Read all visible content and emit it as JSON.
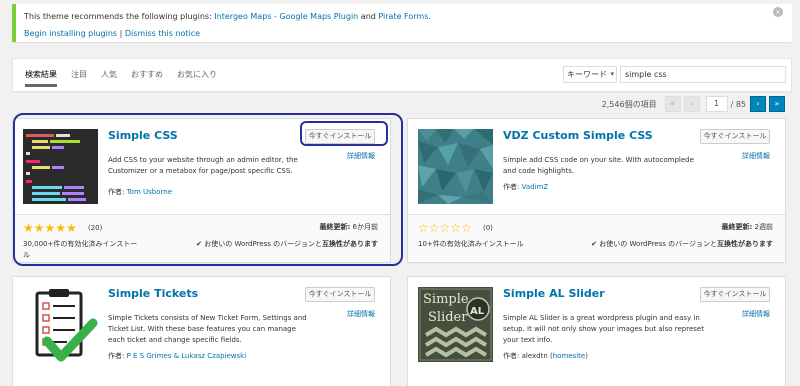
{
  "notice": {
    "text_pre": "This theme recommends the following plugins: ",
    "link1": "Intergeo Maps - Google Maps Plugin",
    "and": " and ",
    "link2": "Pirate Forms",
    "suffix": ".",
    "begin": "Begin installing plugins",
    "sep": " | ",
    "dismiss": "Dismiss this notice",
    "close_icon": "×"
  },
  "tabs": [
    "検索結果",
    "注目",
    "人気",
    "おすすめ",
    "お気に入り"
  ],
  "search": {
    "type": "キーワード",
    "value": "simple css"
  },
  "pagination": {
    "count": "2,546個の項目",
    "first": "«",
    "prev": "‹",
    "current": "1",
    "total": "/ 85",
    "next": "›",
    "last": "»"
  },
  "cards": [
    {
      "name": "Simple CSS",
      "install": "今すぐインストール",
      "details": "詳細情報",
      "desc": "Add CSS to your website through an admin editor, the Customizer or a metabox for page/post specific CSS.",
      "author_label": "作者: ",
      "author": "Tom Usborne",
      "stars": "★★★★★",
      "rating_count": "(20)",
      "installs": "30,000+件の有効化済みインストール",
      "updated_label": "最終更新:",
      "updated": " 6か月前",
      "compat_pre": "✔ お使いの WordPress のバージョンと",
      "compat_bold": "互換性があります"
    },
    {
      "name": "VDZ Custom Simple CSS",
      "install": "今すぐインストール",
      "details": "詳細情報",
      "desc": "Simple add CSS code on your site. With autocomplede and code highlights.",
      "author_label": "作者: ",
      "author": "VadimZ",
      "stars": "☆☆☆☆☆",
      "rating_count": "(0)",
      "installs": "10+件の有効化済みインストール",
      "updated_label": "最終更新:",
      "updated": " 2週前",
      "compat_pre": "✔ お使いの WordPress のバージョンと",
      "compat_bold": "互換性があります"
    },
    {
      "name": "Simple Tickets",
      "install": "今すぐインストール",
      "details": "詳細情報",
      "desc": "Simple Tickets consists of New Ticket Form, Settings and Ticket List. With these base features you can manage each ticket and change specific fields.",
      "author_label": "作者: ",
      "author": "P E S Grimes & Lukasz Czapiewski"
    },
    {
      "name": "Simple AL Slider",
      "install": "今すぐインストール",
      "details": "詳細情報",
      "desc": "Simple AL Slider is a great wordpress plugin and easy in setup. It will not only show your images but also represet your text info.",
      "author_label": "作者: ",
      "author_plain": "alexdtn (",
      "author": "homesite",
      "author_close": ")",
      "thumb_text1": "Simple",
      "thumb_text2": "Slider",
      "thumb_badge": "AL"
    }
  ]
}
